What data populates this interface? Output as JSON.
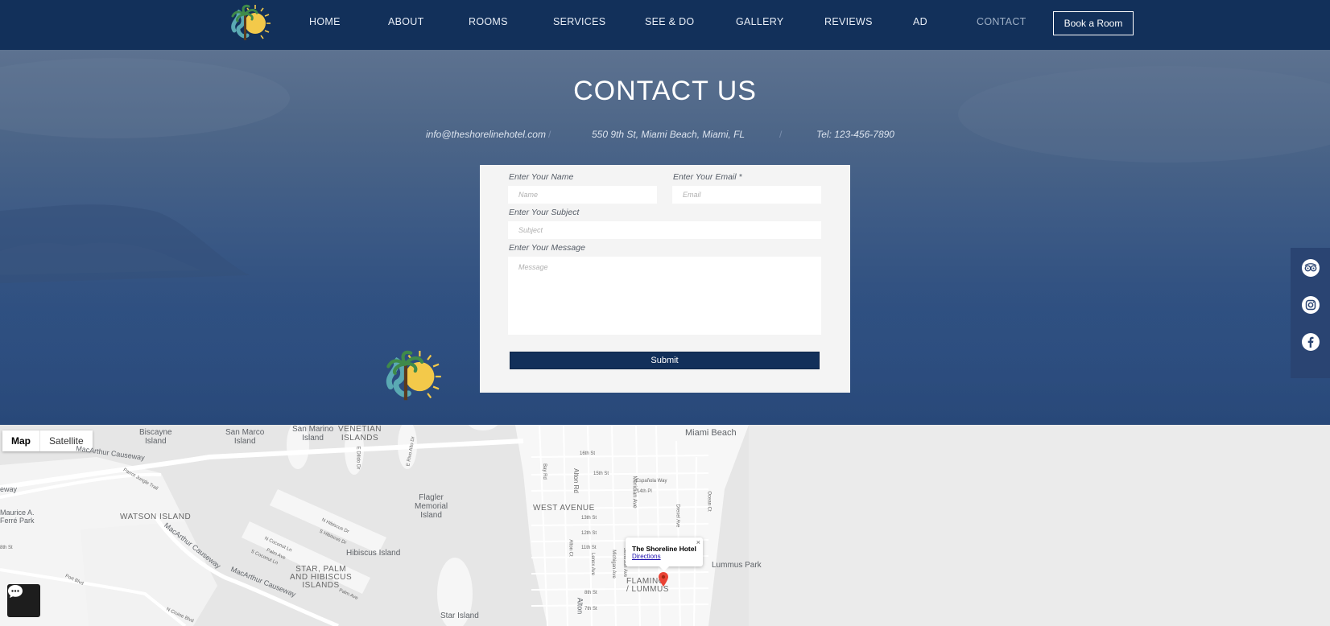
{
  "header": {
    "logo_icon": "shoreline-logo-icon",
    "nav": [
      {
        "label": "HOME"
      },
      {
        "label": "ABOUT"
      },
      {
        "label": "ROOMS"
      },
      {
        "label": "SERVICES"
      },
      {
        "label": "SEE & DO"
      },
      {
        "label": "GALLERY"
      },
      {
        "label": "REVIEWS"
      },
      {
        "label": "AD"
      },
      {
        "label": "CONTACT",
        "active": true
      }
    ],
    "book_label": "Book a Room"
  },
  "hero": {
    "title": "CONTACT US",
    "email": "info@theshorelinehotel.com",
    "address": "550 9th St,  Miami Beach,  Miami,  FL",
    "phone": "Tel: 123-456-7890",
    "separator": "/"
  },
  "form": {
    "name_label": "Enter Your Name",
    "name_placeholder": "Name",
    "email_label": "Enter Your Email *",
    "email_placeholder": "Email",
    "subject_label": "Enter Your Subject",
    "subject_placeholder": "Subject",
    "message_label": "Enter Your Message",
    "message_placeholder": "Message",
    "submit_label": "Submit"
  },
  "social": [
    {
      "icon": "tripadvisor-icon"
    },
    {
      "icon": "instagram-icon"
    },
    {
      "icon": "facebook-icon"
    }
  ],
  "map": {
    "toggle": {
      "map": "Map",
      "satellite": "Satellite"
    },
    "infowindow": {
      "title": "The Shoreline Hotel",
      "link": "Directions",
      "close": "×"
    },
    "labels": {
      "biscayne": "Biscayne\nIsland",
      "san_marco": "San Marco\nIsland",
      "san_marino": "San Marino\nIsland",
      "venetian": "VENETIAN\nISLANDS",
      "miami_beach": "Miami Beach",
      "macarthur1": "MacArthur Causeway",
      "watson": "WATSON ISLAND",
      "flagler": "Flagler\nMemorial\nIsland",
      "west_avenue": "WEST AVENUE",
      "hibiscus": "Hibiscus Island",
      "star_palm": "STAR, PALM\nAND HIBISCUS\nISLANDS",
      "flamingo": "FLAMING\n/ LUMMUS",
      "lummus_park": "Lummus Park",
      "star_island": "Star Island",
      "macarthur2": "MacArthur Causeway",
      "macarthur3": "MacArthur Causeway",
      "alton_rd": "Alton Rd",
      "meridian": "Meridian Ave",
      "st16": "16th St",
      "st15": "15th St",
      "espanola": "Española Way",
      "st14pl": "14th Pl",
      "st13": "13th St",
      "st12": "12th St",
      "st11": "11th St",
      "st8": "8th St",
      "st7": "7th St",
      "maurice": "Maurice A.\nFerré Park",
      "port_blvd": "Port Blvd",
      "parrot": "Parrot Jungle Trail",
      "alton": "Alton",
      "ocean_ct": "Ocean Ct",
      "drexel": "Drexel Ave",
      "michigan": "Michigan Ave",
      "jefferson": "Jefferson Ave",
      "lenox": "Lenox Ave",
      "alton_ct": "Alton Ct",
      "bay_rd": "Bay Rd",
      "n_hibiscus": "N Hibiscus Dr",
      "s_hibiscus": "S Hibiscus Dr",
      "n_coconut": "N Coconut Ln",
      "s_coconut": "S Coconut Ln",
      "palm_ave": "Palm Ave",
      "palm_ave2": "Palm Ave",
      "e_dilido": "E Dilido Dr",
      "e_rivo": "E Rivo Alto Dr",
      "n_cruise": "N Cruise Blvd",
      "st8th": "8th St",
      "eway": "eway"
    },
    "pin_icon": "map-pin-icon",
    "chat_icon": "chat-bubble-icon"
  }
}
